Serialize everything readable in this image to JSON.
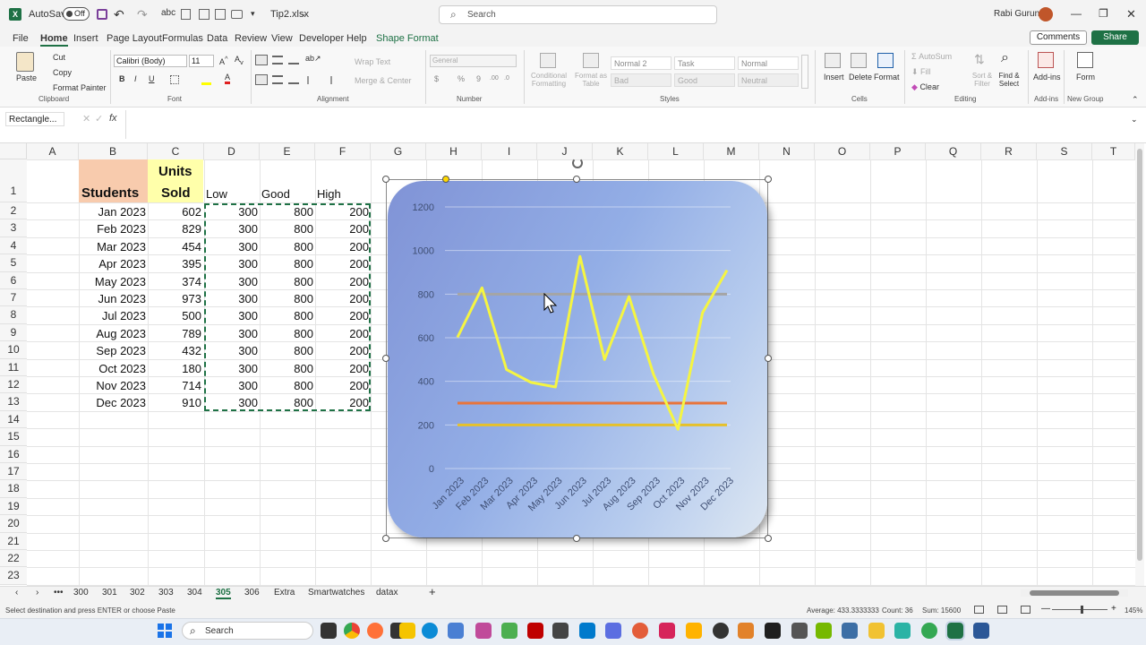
{
  "titlebar": {
    "autosave_label": "AutoSave",
    "autosave_state": "Off",
    "filename": "Tip2.xlsx",
    "search_placeholder": "Search",
    "user_name": "Rabi Gurung"
  },
  "tabs": [
    "File",
    "Home",
    "Insert",
    "Page Layout",
    "Formulas",
    "Data",
    "Review",
    "View",
    "Developer",
    "Help",
    "Shape Format"
  ],
  "active_tab": "Home",
  "share_buttons": {
    "comments": "Comments",
    "share": "Share"
  },
  "ribbon": {
    "clipboard": {
      "label": "Clipboard",
      "paste": "Paste",
      "cut": "Cut",
      "copy": "Copy",
      "format_painter": "Format Painter"
    },
    "font": {
      "label": "Font",
      "family": "Calibri (Body)",
      "size": "11"
    },
    "alignment": {
      "label": "Alignment",
      "wrap": "Wrap Text",
      "merge": "Merge & Center"
    },
    "number": {
      "label": "Number",
      "format": "General"
    },
    "styles": {
      "label": "Styles",
      "conditional": "Conditional Formatting",
      "format_table": "Format as Table",
      "cells": [
        "Normal 2",
        "Task",
        "Normal",
        "Bad",
        "Good",
        "Neutral"
      ]
    },
    "cells": {
      "label": "Cells",
      "insert": "Insert",
      "delete": "Delete",
      "format": "Format"
    },
    "editing": {
      "label": "Editing",
      "autosum": "AutoSum",
      "fill": "Fill",
      "clear": "Clear",
      "sort": "Sort & Filter",
      "find": "Find & Select"
    },
    "addins": {
      "label": "Add-ins",
      "addins": "Add-ins"
    },
    "newgroup": {
      "label": "New Group",
      "form": "Form"
    }
  },
  "formula_bar": {
    "name_box": "Rectangle...",
    "fx": "fx",
    "formula": ""
  },
  "columns": [
    "A",
    "B",
    "C",
    "D",
    "E",
    "F",
    "G",
    "H",
    "I",
    "J",
    "K",
    "L",
    "M",
    "N",
    "O",
    "P",
    "Q",
    "R",
    "S",
    "T"
  ],
  "rows": [
    "1",
    "2",
    "3",
    "4",
    "5",
    "6",
    "7",
    "8",
    "9",
    "10",
    "11",
    "12",
    "13",
    "14",
    "15",
    "16",
    "17",
    "18",
    "19",
    "20",
    "21",
    "22",
    "23"
  ],
  "headers": {
    "students": "Students",
    "units": "Units",
    "sold": "Sold",
    "low": "Low",
    "good": "Good",
    "high": "High"
  },
  "table": [
    {
      "month": "Jan 2023",
      "units": "602",
      "low": "300",
      "good": "800",
      "high": "200"
    },
    {
      "month": "Feb 2023",
      "units": "829",
      "low": "300",
      "good": "800",
      "high": "200"
    },
    {
      "month": "Mar 2023",
      "units": "454",
      "low": "300",
      "good": "800",
      "high": "200"
    },
    {
      "month": "Apr 2023",
      "units": "395",
      "low": "300",
      "good": "800",
      "high": "200"
    },
    {
      "month": "May 2023",
      "units": "374",
      "low": "300",
      "good": "800",
      "high": "200"
    },
    {
      "month": "Jun 2023",
      "units": "973",
      "low": "300",
      "good": "800",
      "high": "200"
    },
    {
      "month": "Jul 2023",
      "units": "500",
      "low": "300",
      "good": "800",
      "high": "200"
    },
    {
      "month": "Aug 2023",
      "units": "789",
      "low": "300",
      "good": "800",
      "high": "200"
    },
    {
      "month": "Sep 2023",
      "units": "432",
      "low": "300",
      "good": "800",
      "high": "200"
    },
    {
      "month": "Oct 2023",
      "units": "180",
      "low": "300",
      "good": "800",
      "high": "200"
    },
    {
      "month": "Nov 2023",
      "units": "714",
      "low": "300",
      "good": "800",
      "high": "200"
    },
    {
      "month": "Dec 2023",
      "units": "910",
      "low": "300",
      "good": "800",
      "high": "200"
    }
  ],
  "chart_data": {
    "type": "line",
    "categories": [
      "Jan 2023",
      "Feb 2023",
      "Mar 2023",
      "Apr 2023",
      "May 2023",
      "Jun 2023",
      "Jul 2023",
      "Aug 2023",
      "Sep 2023",
      "Oct 2023",
      "Nov 2023",
      "Dec 2023"
    ],
    "series": [
      {
        "values": [
          602,
          829,
          454,
          395,
          374,
          973,
          500,
          789,
          432,
          180,
          714,
          910
        ],
        "color": "#f5f542"
      },
      {
        "values": [
          300,
          300,
          300,
          300,
          300,
          300,
          300,
          300,
          300,
          300,
          300,
          300
        ],
        "color": "#e8743b"
      },
      {
        "values": [
          800,
          800,
          800,
          800,
          800,
          800,
          800,
          800,
          800,
          800,
          800,
          800
        ],
        "color": "#a5a5a5"
      },
      {
        "values": [
          200,
          200,
          200,
          200,
          200,
          200,
          200,
          200,
          200,
          200,
          200,
          200
        ],
        "color": "#e6c12a"
      }
    ],
    "yticks": [
      "0",
      "200",
      "400",
      "600",
      "800",
      "1000",
      "1200"
    ],
    "ylim": [
      0,
      1200
    ],
    "grid": true
  },
  "sheet_tabs": [
    "300",
    "301",
    "302",
    "303",
    "304",
    "305",
    "306",
    "Extra",
    "Smartwatches",
    "datax"
  ],
  "active_sheet": "305",
  "status": {
    "message": "Select destination and press ENTER or choose Paste",
    "average": "Average: 433.3333333",
    "count": "Count: 36",
    "sum": "Sum: 15600",
    "zoom": "145%"
  },
  "taskbar": {
    "search": "Search"
  }
}
